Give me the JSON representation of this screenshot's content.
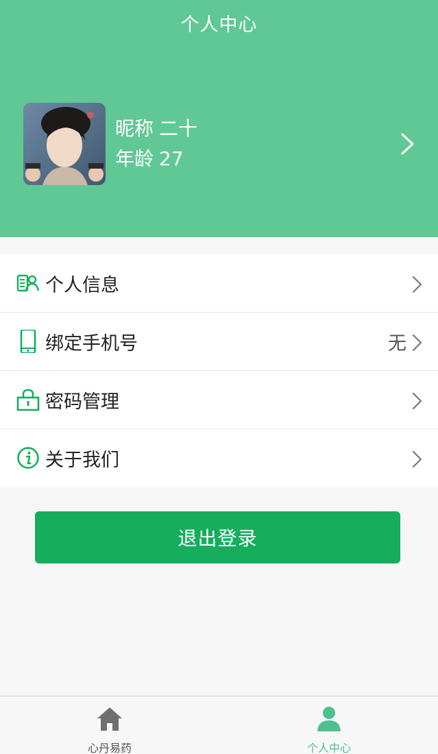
{
  "header": {
    "title": "个人中心",
    "nickname_label": "昵称",
    "nickname": "二十",
    "age_label": "年龄",
    "age": "27"
  },
  "menu": {
    "items": [
      {
        "label": "个人信息",
        "icon": "profile-card-icon"
      },
      {
        "label": "绑定手机号",
        "value": "无",
        "icon": "phone-icon"
      },
      {
        "label": "密码管理",
        "icon": "lock-icon"
      },
      {
        "label": "关于我们",
        "icon": "info-icon"
      }
    ]
  },
  "logout_label": "退出登录",
  "tabbar": {
    "items": [
      {
        "label": "心丹易药",
        "icon": "home-icon"
      },
      {
        "label": "个人中心",
        "icon": "user-icon",
        "active": true
      }
    ]
  },
  "colors": {
    "header": "#60c895",
    "accent": "#15ae5c",
    "tab_active": "#4fc08d"
  }
}
